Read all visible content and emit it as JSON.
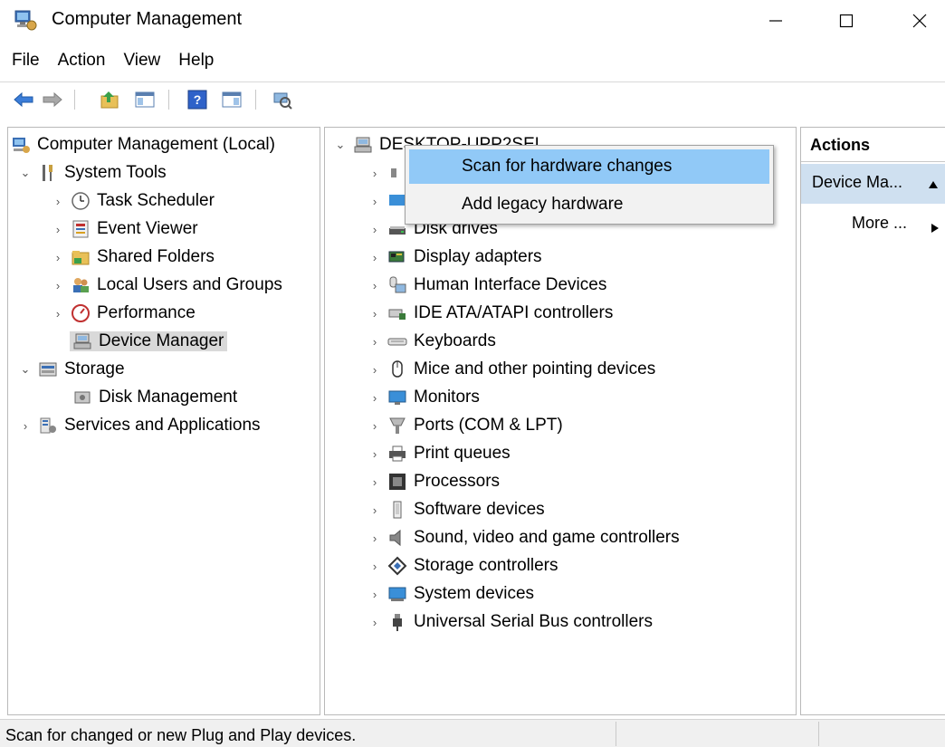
{
  "window": {
    "title": "Computer Management"
  },
  "menu": [
    "File",
    "Action",
    "View",
    "Help"
  ],
  "tree": {
    "root": "Computer Management (Local)",
    "system_tools": "System Tools",
    "task_scheduler": "Task Scheduler",
    "event_viewer": "Event Viewer",
    "shared_folders": "Shared Folders",
    "local_users": "Local Users and Groups",
    "performance": "Performance",
    "device_manager": "Device Manager",
    "storage": "Storage",
    "disk_management": "Disk Management",
    "services": "Services and Applications"
  },
  "devices": {
    "computer": "DESKTOP-UPP2SEL",
    "items": [
      "Disk drives",
      "Display adapters",
      "Human Interface Devices",
      "IDE ATA/ATAPI controllers",
      "Keyboards",
      "Mice and other pointing devices",
      "Monitors",
      "Ports (COM & LPT)",
      "Print queues",
      "Processors",
      "Software devices",
      "Sound, video and game controllers",
      "Storage controllers",
      "System devices",
      "Universal Serial Bus controllers"
    ]
  },
  "context_menu": [
    "Scan for hardware changes",
    "Add legacy hardware"
  ],
  "actions": {
    "header": "Actions",
    "selected": "Device Ma...",
    "more": "More ..."
  },
  "status": {
    "text": "Scan for changed or new Plug and Play devices."
  }
}
